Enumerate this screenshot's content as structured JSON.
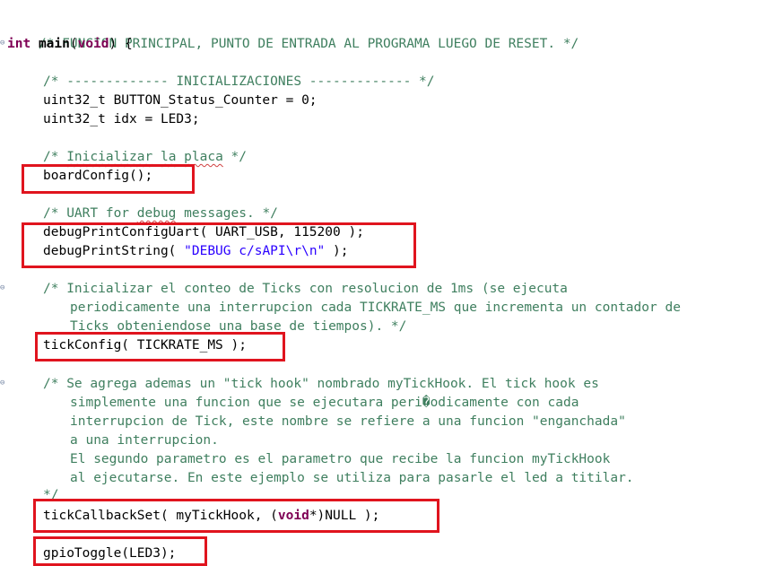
{
  "code": {
    "header_comment": "/* FUNCION PRINCIPAL, PUNTO DE ENTRADA AL PROGRAMA LUEGO DE RESET. */",
    "main_kw": "int",
    "main_name": "main",
    "main_open": "(",
    "main_void": "void",
    "main_close": ") {",
    "init_comment": "/* ------------- INICIALIZACIONES ------------- */",
    "var1": "uint32_t BUTTON_Status_Counter = 0;",
    "var2": "uint32_t idx = LED3;",
    "board_comment_a": "/* ",
    "board_comment_b": "Inicializar",
    "board_comment_c": " ",
    "board_comment_d": "la",
    "board_comment_e": " ",
    "board_comment_f": "placa",
    "board_comment_g": " */",
    "board_call": "boardConfig();",
    "uart_comment_a": "/* UART for ",
    "uart_comment_b": "debug",
    "uart_comment_c": " messages. */",
    "uart_call": "debugPrintConfigUart( UART_USB, 115200 );",
    "print_call_a": "debugPrintString( ",
    "print_call_str": "\"DEBUG c/sAPI\\r\\n\"",
    "print_call_b": " );",
    "tick_comment_l1": "/* Inicializar el conteo de Ticks con resolucion de 1ms (se ejecuta",
    "tick_comment_l2": "periodicamente una interrupcion cada TICKRATE_MS que incrementa un contador de",
    "tick_comment_l3": "Ticks obteniendose una base de tiempos). */",
    "tick_call": "tickConfig( TICKRATE_MS );",
    "hook_comment_l1": "/* Se agrega ademas un \"tick hook\" nombrado myTickHook. El tick hook es",
    "hook_comment_l2": "simplemente una funcion que se ejecutara peri�odicamente con cada",
    "hook_comment_l3": "interrupcion de Tick, este nombre se refiere a una funcion \"enganchada\"",
    "hook_comment_l4": "a una interrupcion.",
    "hook_comment_l5": "El segundo parametro es el parametro que recibe la funcion myTickHook",
    "hook_comment_l6": "al ejecutarse. En este ejemplo se utiliza para pasarle el led a titilar.",
    "hook_comment_end": "*/",
    "callback_a": "tickCallbackSet( myTickHook, (",
    "callback_void": "void",
    "callback_b": "*)NULL );",
    "toggle_call": "gpioToggle(LED3);"
  },
  "colors": {
    "comment": "#3f7f5f",
    "keyword": "#7f0055",
    "string": "#2a00ff",
    "highlight_box": "#e0141e"
  }
}
